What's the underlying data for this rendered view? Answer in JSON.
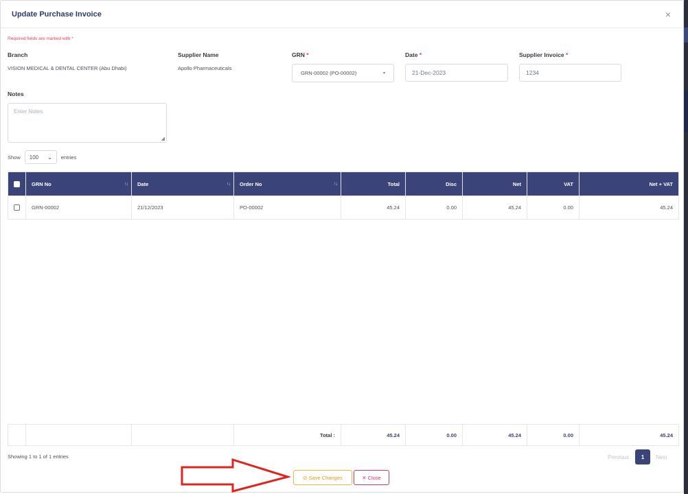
{
  "modal": {
    "title": "Update Purchase Invoice",
    "close_symbol": "×",
    "required_note": "Required fields are marked with *"
  },
  "form": {
    "branch": {
      "label": "Branch",
      "value": "VISION MEDICAL & DENTAL CENTER (Abu Dhabi)"
    },
    "supplier": {
      "label": "Supplier Name",
      "value": "Apollo Pharmaceuticals"
    },
    "grn": {
      "label": "GRN",
      "required": "*",
      "value": "GRN-00002  (PO-00002)"
    },
    "date": {
      "label": "Date",
      "required": "*",
      "value": "21-Dec-2023"
    },
    "supplier_invoice": {
      "label": "Supplier Invoice",
      "required": "*",
      "value": "1234"
    },
    "notes": {
      "label": "Notes",
      "placeholder": "Enter Notes"
    }
  },
  "entries": {
    "show": "Show",
    "value": "100",
    "suffix": "entries"
  },
  "table": {
    "columns": [
      "GRN No",
      "Date",
      "Order No",
      "Total",
      "Disc",
      "Net",
      "VAT",
      "Net + VAT"
    ],
    "rows": [
      {
        "grn_no": "GRN-00002",
        "date": "21/12/2023",
        "order_no": "PO-00002",
        "total": "45.24",
        "disc": "0.00",
        "net": "45.24",
        "vat": "0.00",
        "net_vat": "45.24"
      }
    ],
    "footer": {
      "label": "Total :",
      "total": "45.24",
      "disc": "0.00",
      "net": "45.24",
      "vat": "0.00",
      "net_vat": "45.24"
    }
  },
  "pagination": {
    "info": "Showing 1 to 1 of 1 entries",
    "previous": "Previous",
    "current": "1",
    "next": "Next"
  },
  "actions": {
    "save_label": "Save Changes",
    "close_label": "Close"
  },
  "colors": {
    "header_bg": "#3b4478",
    "save_accent": "#e89c11",
    "close_accent": "#d6337a",
    "required": "#e0435b",
    "arrow": "#e3231b"
  }
}
